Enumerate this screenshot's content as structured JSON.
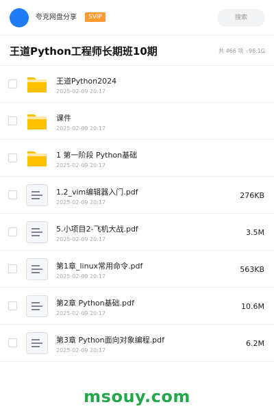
{
  "header": {
    "uploader": "夸克网盘分享",
    "badge": "SVIP",
    "search_placeholder": "搜索"
  },
  "title_bar": {
    "title": "王道Python工程师长期班10期",
    "summary": "共 466 项 · 96.1G"
  },
  "colors": {
    "avatar": "#1f7cf5",
    "badge": "#ff9a2e",
    "folder": "#ffc000",
    "watermark": "#22a84a"
  },
  "files": [
    {
      "type": "folder",
      "icon": "folder-icon",
      "name": "王道Python2024",
      "time": "2025-02-09 20:17",
      "size": ""
    },
    {
      "type": "folder",
      "icon": "folder-icon",
      "name": "课件",
      "time": "2025-02-09 20:17",
      "size": ""
    },
    {
      "type": "folder",
      "icon": "folder-icon",
      "name": "1 第一阶段 Python基础",
      "time": "2025-02-09 20:17",
      "size": ""
    },
    {
      "type": "file",
      "icon": "document-icon",
      "name": "1.2_vim编辑器入门.pdf",
      "time": "2025-02-09 20:17",
      "size": "276KB"
    },
    {
      "type": "file",
      "icon": "document-icon",
      "name": "5.小项目2-飞机大战.pdf",
      "time": "2025-02-09 20:17",
      "size": "3.5M"
    },
    {
      "type": "file",
      "icon": "document-icon",
      "name": "第1章_linux常用命令.pdf",
      "time": "2025-02-09 20:17",
      "size": "563KB"
    },
    {
      "type": "file",
      "icon": "document-icon",
      "name": "第2章 Python基础.pdf",
      "time": "2025-02-09 20:17",
      "size": "10.6M"
    },
    {
      "type": "file",
      "icon": "document-icon",
      "name": "第3章 Python面向对象编程.pdf",
      "time": "2025-02-09 20:17",
      "size": "6.2M"
    }
  ],
  "watermark": "msouy.com"
}
